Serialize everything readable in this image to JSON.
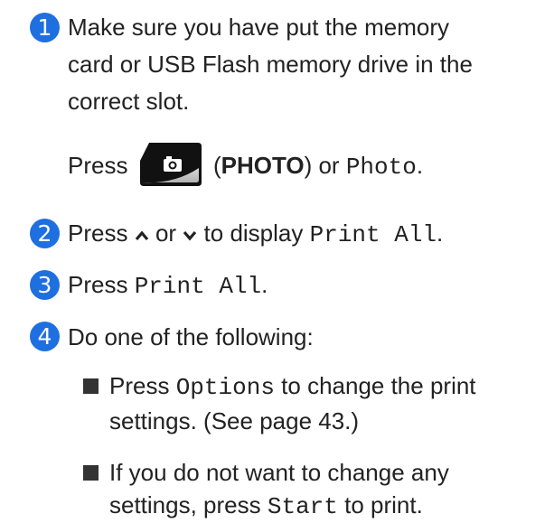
{
  "accent_color": "#1e6fe0",
  "steps": [
    {
      "number": "1",
      "lines": [
        "Make sure you have put the memory",
        "card or USB Flash memory drive in the",
        "correct slot."
      ],
      "press_prefix": "Press",
      "photo_button_icon": "camera-icon",
      "photo_label_open": "(",
      "photo_label_bold": "PHOTO",
      "photo_label_close": ") or",
      "photo_mono": "Photo",
      "photo_end": "."
    },
    {
      "number": "2",
      "prefix": "Press",
      "up_icon": "chevron-up-icon",
      "or": "or",
      "down_icon": "chevron-down-icon",
      "middle": "to display",
      "mono": "Print All",
      "end": "."
    },
    {
      "number": "3",
      "prefix": "Press",
      "mono": "Print All",
      "end": "."
    },
    {
      "number": "4",
      "text": "Do one of the following:",
      "bullets": [
        {
          "prefix": "Press",
          "mono": "Options",
          "after": "to change the print",
          "line2": "settings. (See page 43.)"
        },
        {
          "line1": "If you do not want to change any",
          "line2_prefix": "settings, press",
          "mono": "Start",
          "line2_end": "to print."
        }
      ]
    }
  ]
}
